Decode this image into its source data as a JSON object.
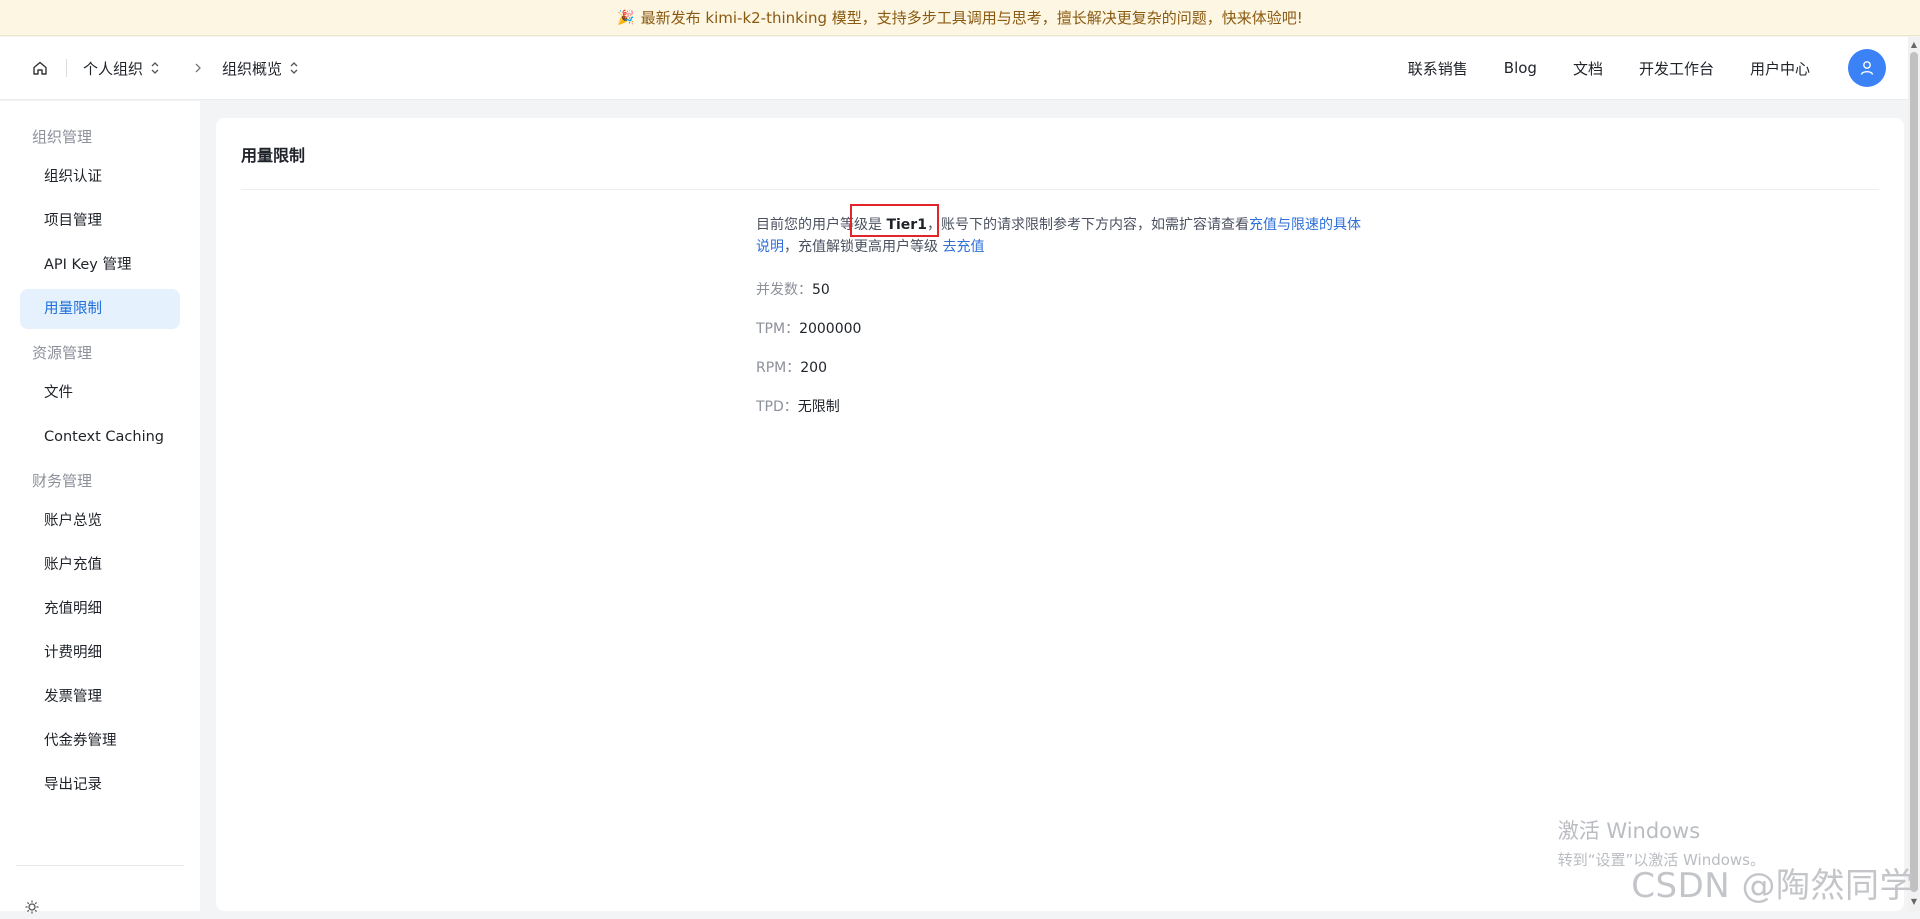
{
  "announcement": {
    "text": "最新发布 kimi-k2-thinking 模型，支持多步工具调用与思考，擅长解决更复杂的问题，快来体验吧!"
  },
  "header": {
    "org_label": "个人组织",
    "page_label": "组织概览",
    "nav": [
      "联系销售",
      "Blog",
      "文档",
      "开发工作台",
      "用户中心"
    ]
  },
  "sidebar": {
    "groups": [
      {
        "title": "组织管理",
        "items": [
          "组织认证",
          "项目管理",
          "API Key 管理",
          "用量限制"
        ]
      },
      {
        "title": "资源管理",
        "items": [
          "文件",
          "Context Caching"
        ]
      },
      {
        "title": "财务管理",
        "items": [
          "账户总览",
          "账户充值",
          "充值明细",
          "计费明细",
          "发票管理",
          "代金券管理",
          "导出记录"
        ]
      }
    ],
    "active_item": "用量限制"
  },
  "main": {
    "title": "用量限制",
    "intro_prefix": "目前您的用户等级是 ",
    "tier": "Tier1",
    "intro_middle": "，账号下的请求限制参考下方内容，如需扩容请查看",
    "link_limits": "充值与限速的具体说明",
    "intro_suffix": "，充值解锁更高用户等级 ",
    "link_recharge": "去充值",
    "limits": [
      {
        "key": "并发数：",
        "value": "50"
      },
      {
        "key": "TPM：",
        "value": "2000000"
      },
      {
        "key": "RPM：",
        "value": "200"
      },
      {
        "key": "TPD：",
        "value": "无限制"
      }
    ]
  },
  "watermark": {
    "line1": "激活 Windows",
    "line2": "转到“设置”以激活 Windows。",
    "csdn": "CSDN @陶然同学"
  },
  "colors": {
    "accent": "#3b82f6",
    "active_bg": "#e5f1fd",
    "link": "#2f6fd9",
    "highlight_border": "#e0262a"
  }
}
